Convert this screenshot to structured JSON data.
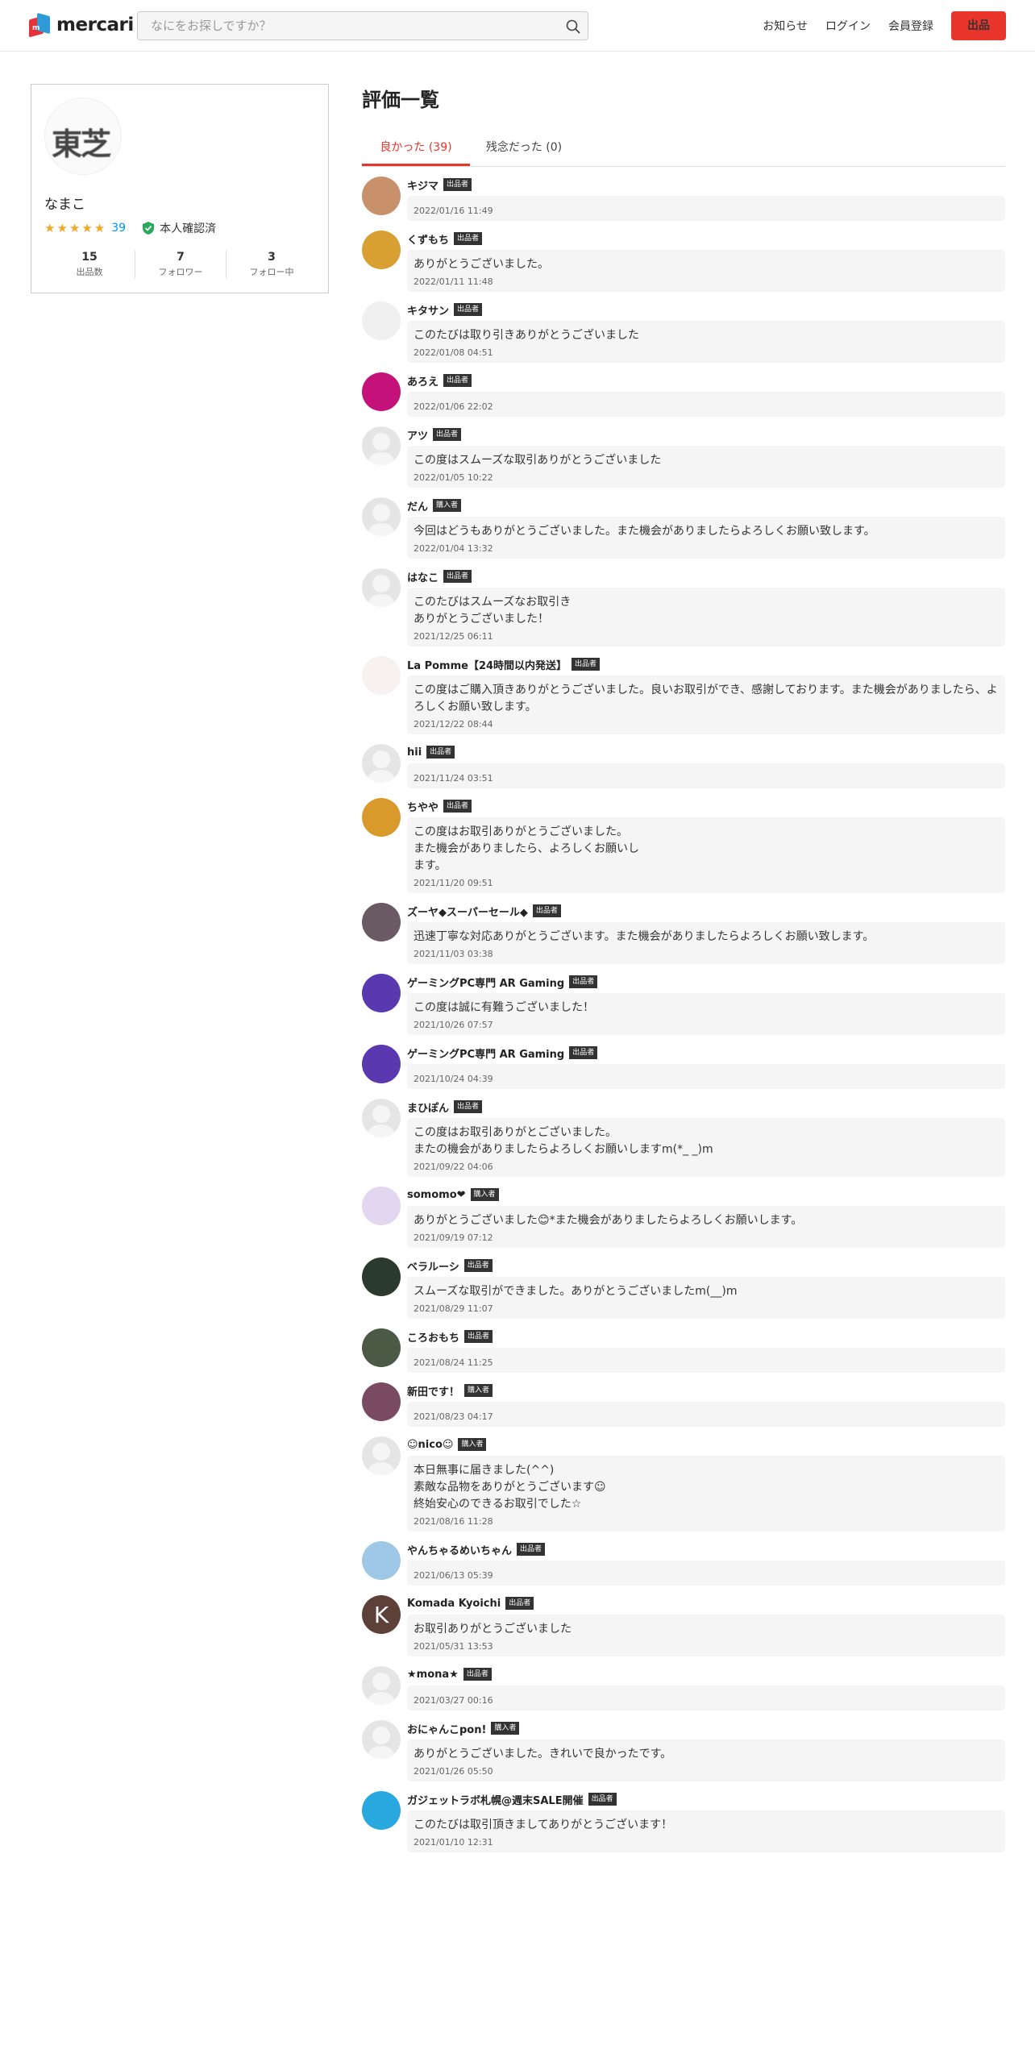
{
  "header": {
    "logo_text": "mercari",
    "search_placeholder": "なにをお探しですか？",
    "nav": {
      "notices": "お知らせ",
      "login": "ログイン",
      "signup": "会員登録",
      "sell": "出品"
    }
  },
  "profile": {
    "avatar_text": "東芝",
    "name": "なまこ",
    "rating_stars": 5,
    "rating_count": "39",
    "verified": "本人確認済",
    "stats": [
      {
        "value": "15",
        "label": "出品数"
      },
      {
        "value": "7",
        "label": "フォロワー"
      },
      {
        "value": "3",
        "label": "フォロー中"
      }
    ]
  },
  "page_title": "評価一覧",
  "tabs": [
    {
      "label": "良かった (39)"
    },
    {
      "label": "残念だった (0)"
    }
  ],
  "reviews": [
    {
      "name": "キジマ",
      "role": "出品者",
      "comment": "",
      "date": "2022/01/16 11:49",
      "avatar": "#c8916b"
    },
    {
      "name": "くずもち",
      "role": "出品者",
      "comment": "ありがとうございました。",
      "date": "2022/01/11 11:48",
      "avatar": "#d8a032"
    },
    {
      "name": "キタサン",
      "role": "出品者",
      "comment": "このたびは取り引きありがとうございました",
      "date": "2022/01/08 04:51",
      "avatar": "#f0f0f0"
    },
    {
      "name": "あろえ",
      "role": "出品者",
      "comment": "",
      "date": "2022/01/06 22:02",
      "avatar": "#c4127a"
    },
    {
      "name": "アツ",
      "role": "出品者",
      "comment": "この度はスムーズな取引ありがとうございました",
      "date": "2022/01/05 10:22",
      "avatar": "default"
    },
    {
      "name": "だん",
      "role": "購入者",
      "comment": "今回はどうもありがとうございました。また機会がありましたらよろしくお願い致します。",
      "date": "2022/01/04 13:32",
      "avatar": "default"
    },
    {
      "name": "はなこ",
      "role": "出品者",
      "comment": "このたびはスムーズなお取引き\nありがとうございました！",
      "date": "2021/12/25 06:11",
      "avatar": "default"
    },
    {
      "name": "La Pomme【24時間以内発送】",
      "role": "出品者",
      "comment": "この度はご購入頂きありがとうございました。良いお取引ができ、感謝しております。また機会がありましたら、よろしくお願い致します。",
      "date": "2021/12/22 08:44",
      "avatar": "#f7f2ef"
    },
    {
      "name": "hii",
      "role": "出品者",
      "comment": "",
      "date": "2021/11/24 03:51",
      "avatar": "default"
    },
    {
      "name": "ちやや",
      "role": "出品者",
      "comment": "この度はお取引ありがとうございました。\nまた機会がありましたら、よろしくお願いし\nます。",
      "date": "2021/11/20 09:51",
      "avatar": "#d99a2b"
    },
    {
      "name": "ズーヤ◆スーパーセール◆",
      "role": "出品者",
      "comment": "迅速丁寧な対応ありがとうございます。また機会がありましたらよろしくお願い致します。",
      "date": "2021/11/03 03:38",
      "avatar": "#6a5a63"
    },
    {
      "name": "ゲーミングPC専門 AR Gaming",
      "role": "出品者",
      "comment": "この度は誠に有難うございました！",
      "date": "2021/10/26 07:57",
      "avatar": "#5a38b0"
    },
    {
      "name": "ゲーミングPC専門 AR Gaming",
      "role": "出品者",
      "comment": "",
      "date": "2021/10/24 04:39",
      "avatar": "#5a38b0"
    },
    {
      "name": "まひぽん",
      "role": "出品者",
      "comment": "この度はお取引ありがとございました。\nまたの機会がありましたらよろしくお願いしますm(*_ _)m",
      "date": "2021/09/22 04:06",
      "avatar": "default"
    },
    {
      "name": "somomo❤",
      "role": "購入者",
      "comment": "ありがとうございました😊*また機会がありましたらよろしくお願いします。",
      "date": "2021/09/19 07:12",
      "avatar": "#e3d6f0"
    },
    {
      "name": "ベラルーシ",
      "role": "出品者",
      "comment": "スムーズな取引ができました。ありがとうございましたm(__)m",
      "date": "2021/08/29 11:07",
      "avatar": "#2b3a2e"
    },
    {
      "name": "ころおもち",
      "role": "出品者",
      "comment": "",
      "date": "2021/08/24 11:25",
      "avatar": "#4a5a44"
    },
    {
      "name": "新田です！",
      "role": "購入者",
      "comment": "",
      "date": "2021/08/23 04:17",
      "avatar": "#7a4a62"
    },
    {
      "name": "☺nico☺",
      "role": "購入者",
      "comment": "本日無事に届きました(^^)\n素敵な品物をありがとうございます☺\n終始安心のできるお取引でした☆",
      "date": "2021/08/16 11:28",
      "avatar": "default"
    },
    {
      "name": "やんちゃるめいちゃん",
      "role": "出品者",
      "comment": "",
      "date": "2021/06/13 05:39",
      "avatar": "#9fc8e6"
    },
    {
      "name": "Komada Kyoichi",
      "role": "出品者",
      "comment": "お取引ありがとうございました",
      "date": "2021/05/31 13:53",
      "avatar": "#5d4037",
      "initial": "K"
    },
    {
      "name": "★mona★",
      "role": "出品者",
      "comment": "",
      "date": "2021/03/27 00:16",
      "avatar": "default"
    },
    {
      "name": "おにゃんこpon!",
      "role": "購入者",
      "comment": "ありがとうございました。きれいで良かったです。",
      "date": "2021/01/26 05:50",
      "avatar": "default"
    },
    {
      "name": "ガジェットラボ札幌@週末SALE開催",
      "role": "出品者",
      "comment": "このたびは取引頂きましてありがとうございます！",
      "date": "2021/01/10 12:31",
      "avatar": "#29a8e0"
    }
  ]
}
